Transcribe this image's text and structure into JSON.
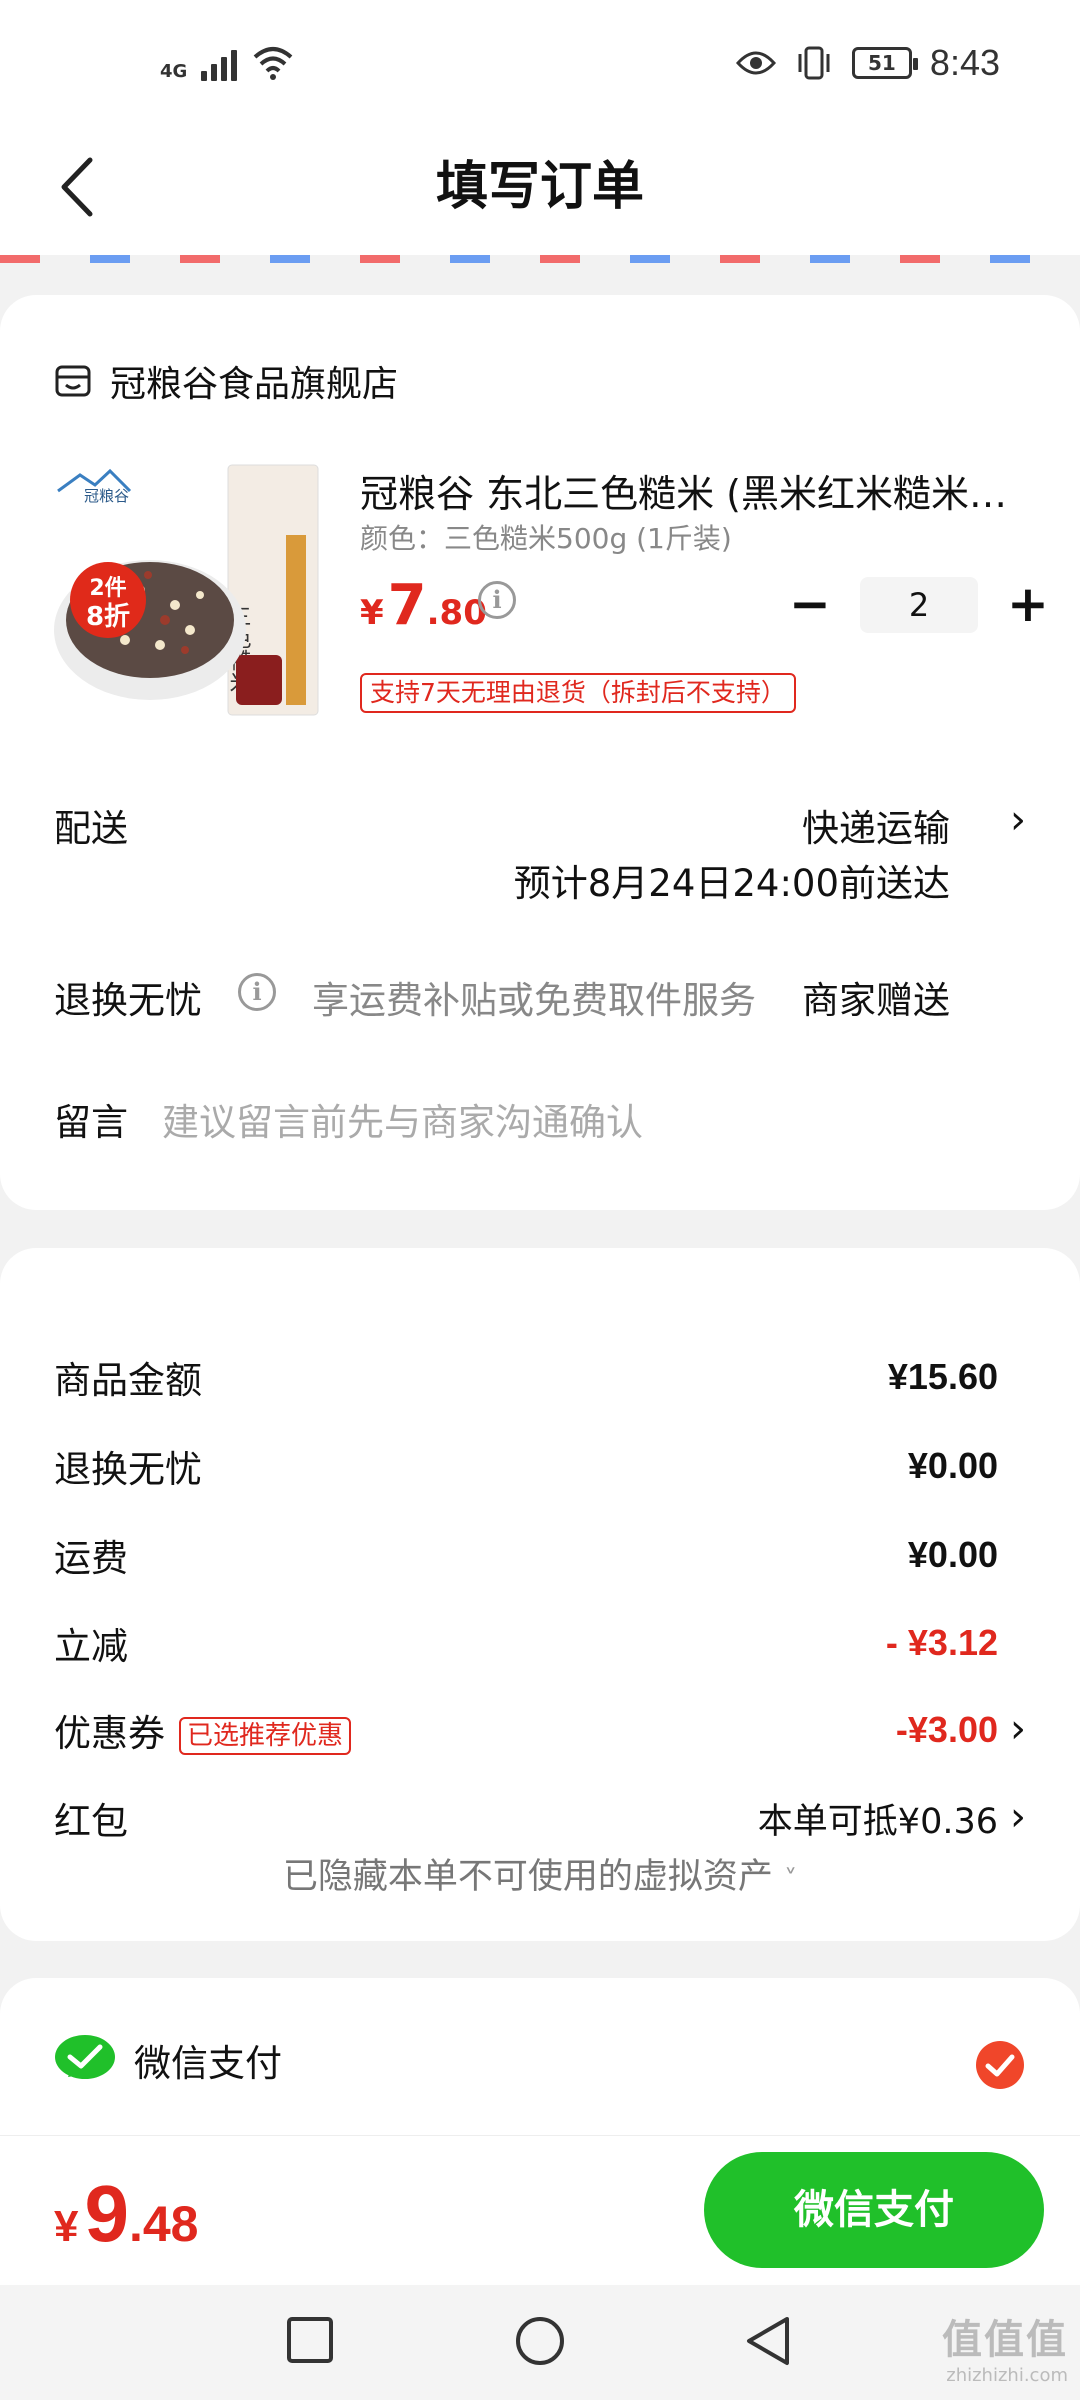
{
  "status_bar": {
    "network": "4G",
    "battery": "51",
    "time": "8:43"
  },
  "header": {
    "title": "填写订单"
  },
  "shop": {
    "name": "冠粮谷食品旗舰店"
  },
  "product": {
    "title": "冠粮谷 东北三色糙米 (黑米红米糙米…",
    "spec": "颜色：三色糙米500g (1斤装)",
    "price_currency": "¥",
    "price_int": "7",
    "price_dec": ".80",
    "quantity": "2",
    "return_policy": "支持7天无理由退货（拆封后不支持）",
    "image_texts": {
      "brand": "冠粮谷",
      "badge_top": "2件",
      "badge_bottom": "8折",
      "pack_text": "三色糙米"
    }
  },
  "delivery": {
    "label": "配送",
    "method": "快递运输",
    "eta": "预计8月24日24:00前送达"
  },
  "worry_free": {
    "label": "退换无忧",
    "desc": "享运费补贴或免费取件服务",
    "value": "商家赠送"
  },
  "message": {
    "label": "留言",
    "placeholder": "建议留言前先与商家沟通确认"
  },
  "summary": {
    "goods_label": "商品金额",
    "goods_value": "¥15.60",
    "worry_label": "退换无忧",
    "worry_value": "¥0.00",
    "shipping_label": "运费",
    "shipping_value": "¥0.00",
    "discount_label": "立减",
    "discount_value": "- ¥3.12",
    "coupon_label": "优惠券",
    "coupon_tag": "已选推荐优惠",
    "coupon_value": "-¥3.00",
    "redpacket_label": "红包",
    "redpacket_value": "本单可抵¥0.36",
    "hidden_assets": "已隐藏本单不可使用的虚拟资产"
  },
  "payment": {
    "method": "微信支付",
    "selected": true
  },
  "bottom": {
    "currency": "¥",
    "total_int": "9",
    "total_dec": ".48",
    "pay_button": "微信支付"
  },
  "watermark": {
    "logo": "值值值",
    "url": "zhizhizhi.com"
  },
  "colors": {
    "accent_red": "#e0281e",
    "wechat_green": "#20c02a",
    "background": "#f2f2f2"
  }
}
